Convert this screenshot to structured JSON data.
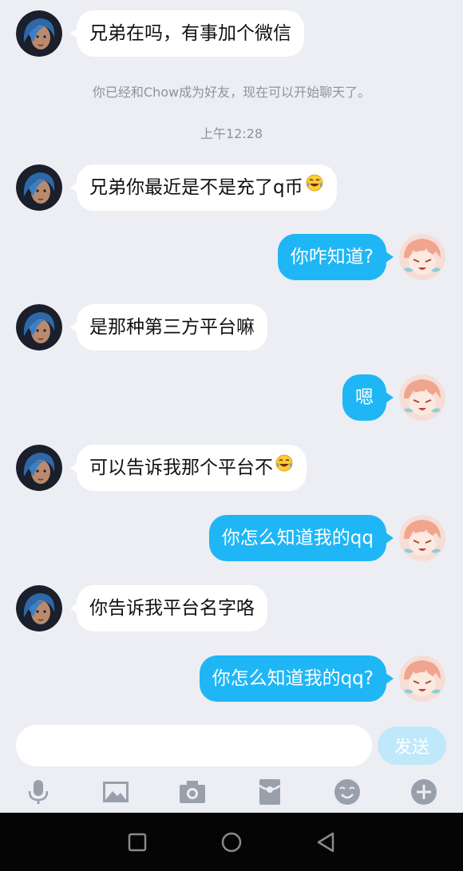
{
  "contact_name": "Chow",
  "system": {
    "friend_notice": "你已经和Chow成为好友，现在可以开始聊天了。",
    "time": "上午12:28"
  },
  "messages": [
    {
      "side": "left",
      "text": "兄弟在吗，有事加个微信",
      "emoji": null
    },
    {
      "side": "left",
      "text": "兄弟你最近是不是充了q币",
      "emoji": "tears-of-joy-emoji"
    },
    {
      "side": "right",
      "text": "你咋知道?",
      "emoji": null
    },
    {
      "side": "left",
      "text": "是那种第三方平台嘛",
      "emoji": null
    },
    {
      "side": "right",
      "text": "嗯",
      "emoji": null
    },
    {
      "side": "left",
      "text": "可以告诉我那个平台不",
      "emoji": "tears-of-joy-emoji"
    },
    {
      "side": "right",
      "text": "你怎么知道我的qq",
      "emoji": null
    },
    {
      "side": "left",
      "text": "你告诉我平台名字咯",
      "emoji": null
    },
    {
      "side": "right",
      "text": "你怎么知道我的qq?",
      "emoji": null
    }
  ],
  "input": {
    "value": "",
    "placeholder": ""
  },
  "send_label": "发送",
  "toolbar_icons": [
    "microphone-icon",
    "image-icon",
    "camera-icon",
    "red-packet-icon",
    "emoji-face-icon",
    "plus-icon"
  ],
  "nav_icons": [
    "recents-square-icon",
    "home-circle-icon",
    "back-triangle-icon"
  ],
  "colors": {
    "background": "#eceef3",
    "incoming_bubble": "#ffffff",
    "outgoing_bubble": "#1fb6f5",
    "send_button_disabled": "#bfe8fa",
    "toolbar_icon": "#9aa0ab"
  }
}
